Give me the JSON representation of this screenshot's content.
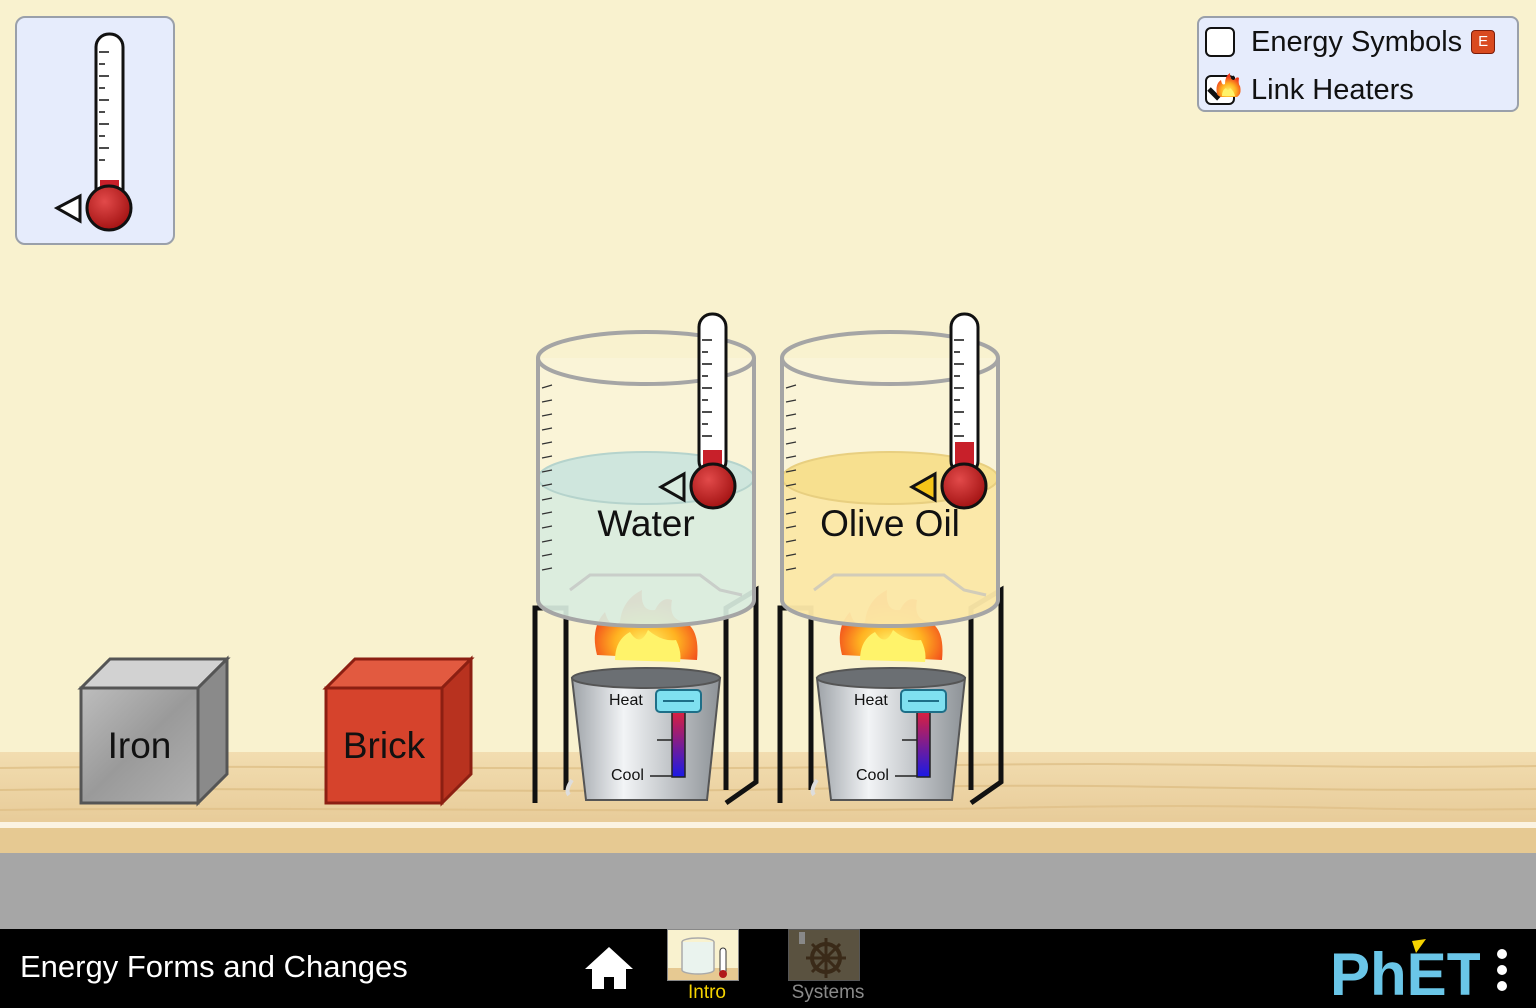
{
  "controls": {
    "energy_symbols_label": "Energy Symbols",
    "energy_symbols_checked": false,
    "energy_symbols_badge": "E",
    "link_heaters_label": "Link Heaters",
    "link_heaters_checked": true
  },
  "blocks": {
    "iron_label": "Iron",
    "brick_label": "Brick"
  },
  "beakers": {
    "water_label": "Water",
    "olive_oil_label": "Olive Oil"
  },
  "burners": {
    "heat_label": "Heat",
    "cool_label": "Cool"
  },
  "navbar": {
    "sim_title": "Energy Forms and Changes",
    "tabs": [
      {
        "label": "Intro",
        "active": true
      },
      {
        "label": "Systems",
        "active": false
      }
    ],
    "logo": "PhET"
  },
  "colors": {
    "background": "#f9f2cf",
    "shelf": "#e8cfa0",
    "control_bar": "#a6a6a6",
    "navbar": "#000000",
    "active_tab": "#f5d300",
    "brick": "#d6432c",
    "iron": "#9e9e9e",
    "water": "#d8ecdf",
    "olive_oil": "#fbe7a6"
  }
}
